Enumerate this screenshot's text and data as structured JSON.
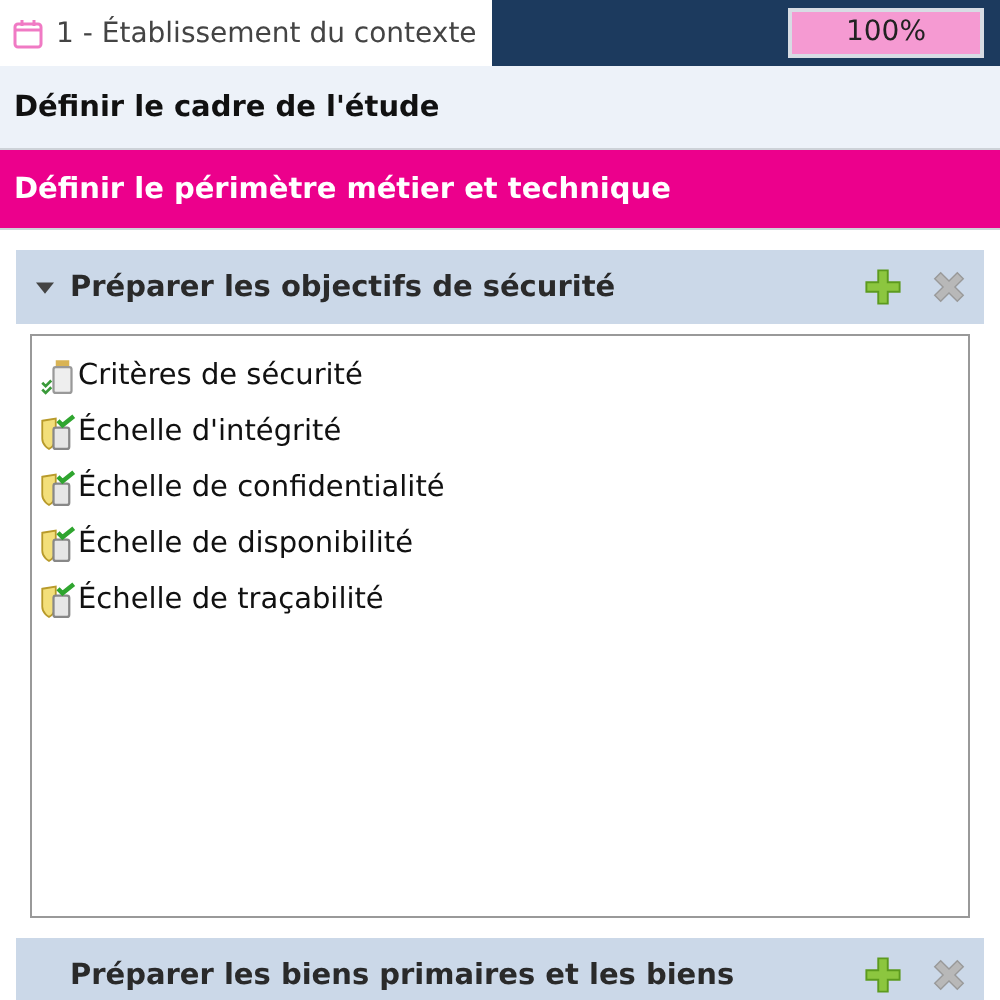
{
  "tab": {
    "label": "1 - Établissement du contexte",
    "selected": true
  },
  "progress": {
    "level": 1,
    "reading": "100%"
  },
  "steps": [
    {
      "label": "Définir le cadre de l'étude",
      "selected": false
    },
    {
      "label": "Définir le périmètre métier et technique",
      "selected": true
    }
  ],
  "sections": [
    {
      "title": "Préparer les objectifs de sécurité",
      "expanded": true,
      "items": [
        {
          "label": "Critères de sécurité",
          "kind": "criteria"
        },
        {
          "label": "Échelle d'intégrité",
          "kind": "scale"
        },
        {
          "label": "Échelle de confidentialité",
          "kind": "scale"
        },
        {
          "label": "Échelle de disponibilité",
          "kind": "scale"
        },
        {
          "label": "Échelle de traçabilité",
          "kind": "scale"
        }
      ]
    },
    {
      "title": "Préparer les biens primaires et les biens",
      "expanded": false
    }
  ]
}
